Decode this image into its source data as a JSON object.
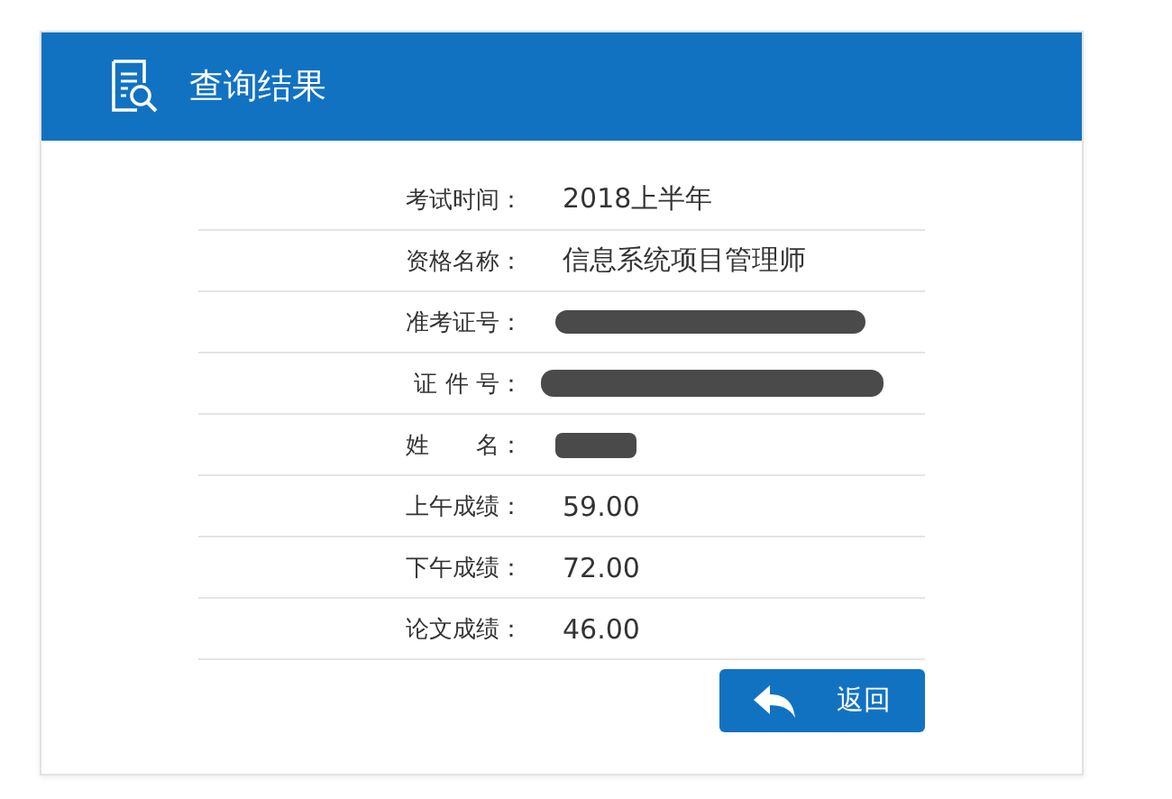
{
  "header": {
    "title": "查询结果"
  },
  "rows": [
    {
      "label": "考试时间：",
      "kind": "text",
      "value": "2018上半年"
    },
    {
      "label": "资格名称：",
      "kind": "text",
      "value": "信息系统项目管理师"
    },
    {
      "label": "准考证号：",
      "kind": "redacted"
    },
    {
      "label": "证 件 号：",
      "kind": "redacted"
    },
    {
      "label": "姓　　名：",
      "kind": "redacted"
    },
    {
      "label": "上午成绩：",
      "kind": "text",
      "value": "59.00"
    },
    {
      "label": "下午成绩：",
      "kind": "text",
      "value": "72.00"
    },
    {
      "label": "论文成绩：",
      "kind": "text",
      "value": "46.00"
    }
  ],
  "back_button": {
    "label": "返回"
  }
}
